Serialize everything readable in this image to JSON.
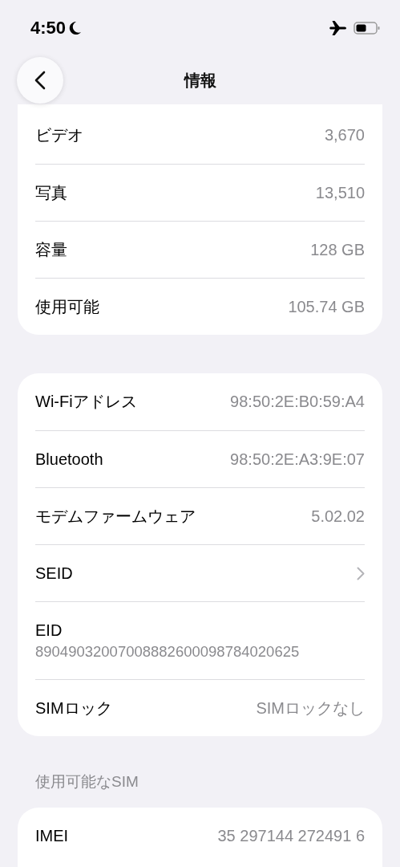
{
  "status_bar": {
    "time": "4:50"
  },
  "nav": {
    "title": "情報"
  },
  "sections": [
    {
      "cut_top": true,
      "rows": [
        {
          "kind": "value",
          "label": "ビデオ",
          "value": "3,670"
        },
        {
          "kind": "value",
          "label": "写真",
          "value": "13,510"
        },
        {
          "kind": "value",
          "label": "容量",
          "value": "128 GB"
        },
        {
          "kind": "value",
          "label": "使用可能",
          "value": "105.74 GB"
        }
      ]
    },
    {
      "cut_top": false,
      "rows": [
        {
          "kind": "value",
          "label": "Wi-Fiアドレス",
          "value": "98:50:2E:B0:59:A4"
        },
        {
          "kind": "value",
          "label": "Bluetooth",
          "value": "98:50:2E:A3:9E:07"
        },
        {
          "kind": "value",
          "label": "モデムファームウェア",
          "value": "5.02.02"
        },
        {
          "kind": "chevron",
          "label": "SEID"
        },
        {
          "kind": "stacked",
          "label": "EID",
          "value": "89049032007008882600098784020625"
        },
        {
          "kind": "value",
          "label": "SIMロック",
          "value": "SIMロックなし"
        }
      ]
    },
    {
      "cut_top": false,
      "header": "使用可能なSIM",
      "rows": [
        {
          "kind": "value",
          "label": "IMEI",
          "value": "35 297144 272491 6"
        }
      ]
    }
  ]
}
